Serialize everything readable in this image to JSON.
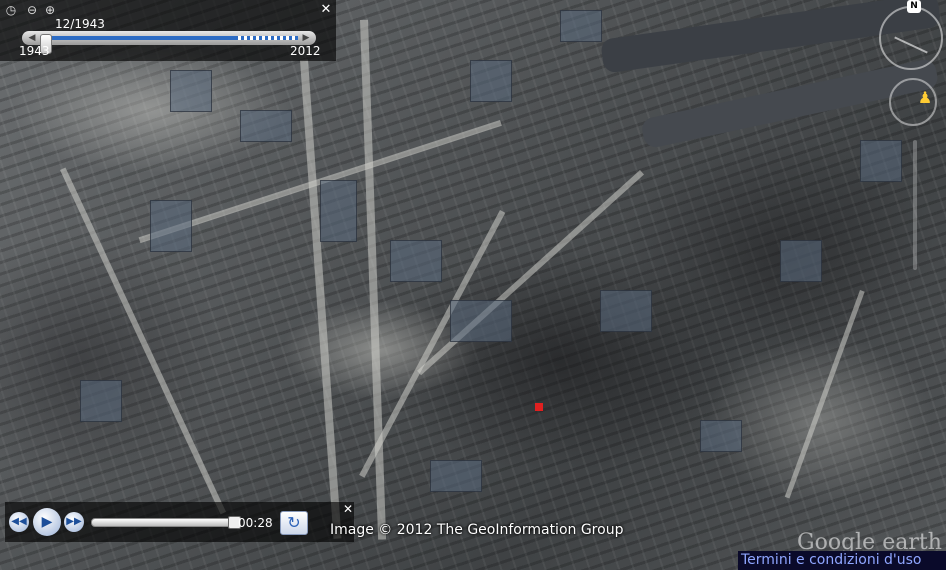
{
  "time_slider": {
    "current_date": "12/1943",
    "start_year": "1943",
    "end_year": "2012",
    "position": 0.0
  },
  "playback": {
    "time": "00:28",
    "progress": 1.0
  },
  "attribution": {
    "image_credit": "Image © 2012 The GeoInformation Group",
    "terms": "Termini e condizioni d'uso",
    "logo": "Google earth"
  },
  "compass": {
    "north_label": "N"
  },
  "icons": {
    "clock": "clock-icon",
    "zoom_out": "zoom-out-icon",
    "zoom_in": "zoom-in-icon",
    "close": "close-icon",
    "rewind": "rewind-icon",
    "play": "play-icon",
    "forward": "forward-icon",
    "loop": "loop-icon",
    "person": "street-view-person-icon"
  },
  "colors": {
    "slider_fill": "#2d6cc4",
    "terms_text": "#8fa6ff",
    "terms_bg": "#0a0a2a",
    "panel_bg": "rgba(0,0,0,0.62)"
  }
}
